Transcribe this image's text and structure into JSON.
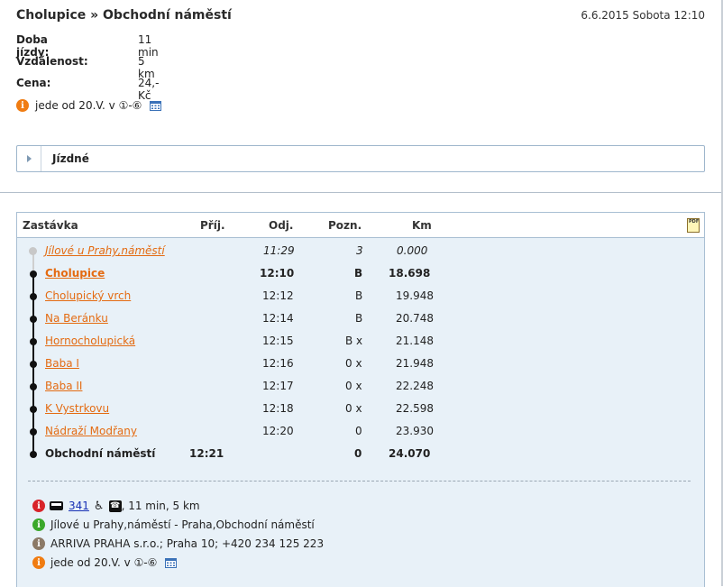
{
  "header": {
    "route_title": "Cholupice » Obchodní náměstí",
    "datetime": "6.6.2015 Sobota 12:10"
  },
  "info": {
    "duration_label": "Doba jízdy:",
    "duration_value": "11 min",
    "distance_label": "Vzdálenost:",
    "distance_value": "5 km",
    "price_label": "Cena:",
    "price_value": "24,- Kč",
    "note_text": "jede od 20.V. v ①-⑥"
  },
  "fares": {
    "label": "Jízdné"
  },
  "table": {
    "headers": {
      "stop": "Zastávka",
      "arr": "Příj.",
      "dep": "Odj.",
      "note": "Pozn.",
      "km": "Km"
    },
    "pdf_label": "PDF",
    "rows": [
      {
        "name": "Jílové u Prahy,náměstí",
        "arr": "",
        "dep": "11:29",
        "note": "3",
        "km": "0.000"
      },
      {
        "name": "Cholupice",
        "arr": "",
        "dep": "12:10",
        "note": "B",
        "km": "18.698"
      },
      {
        "name": "Cholupický vrch",
        "arr": "",
        "dep": "12:12",
        "note": "B",
        "km": "19.948"
      },
      {
        "name": "Na Beránku",
        "arr": "",
        "dep": "12:14",
        "note": "B",
        "km": "20.748"
      },
      {
        "name": "Hornocholupická",
        "arr": "",
        "dep": "12:15",
        "note": "B x",
        "km": "21.148"
      },
      {
        "name": "Baba I",
        "arr": "",
        "dep": "12:16",
        "note": "0 x",
        "km": "21.948"
      },
      {
        "name": "Baba II",
        "arr": "",
        "dep": "12:17",
        "note": "0 x",
        "km": "22.248"
      },
      {
        "name": "K Vystrkovu",
        "arr": "",
        "dep": "12:18",
        "note": "0 x",
        "km": "22.598"
      },
      {
        "name": "Nádraží Modřany",
        "arr": "",
        "dep": "12:20",
        "note": "0",
        "km": "23.930"
      },
      {
        "name": "Obchodní náměstí",
        "arr": "12:21",
        "dep": "",
        "note": "0",
        "km": "24.070"
      }
    ]
  },
  "legend": {
    "line_number": "341",
    "line_summary": ", 11 min, 5 km",
    "route_text": "Jílové u Prahy,náměstí - Praha,Obchodní náměstí",
    "operator_text": "ARRIVA PRAHA s.r.o.; Praha 10; +420 234 125 223",
    "note_text": "jede od 20.V. v ①-⑥",
    "info_glyph": "i",
    "tel_glyph": "☎",
    "wheelchair_glyph": "♿"
  },
  "colors": {
    "accent": "#e46b12",
    "panel_bg": "#e8f1f8",
    "link_blue": "#1730b5"
  }
}
